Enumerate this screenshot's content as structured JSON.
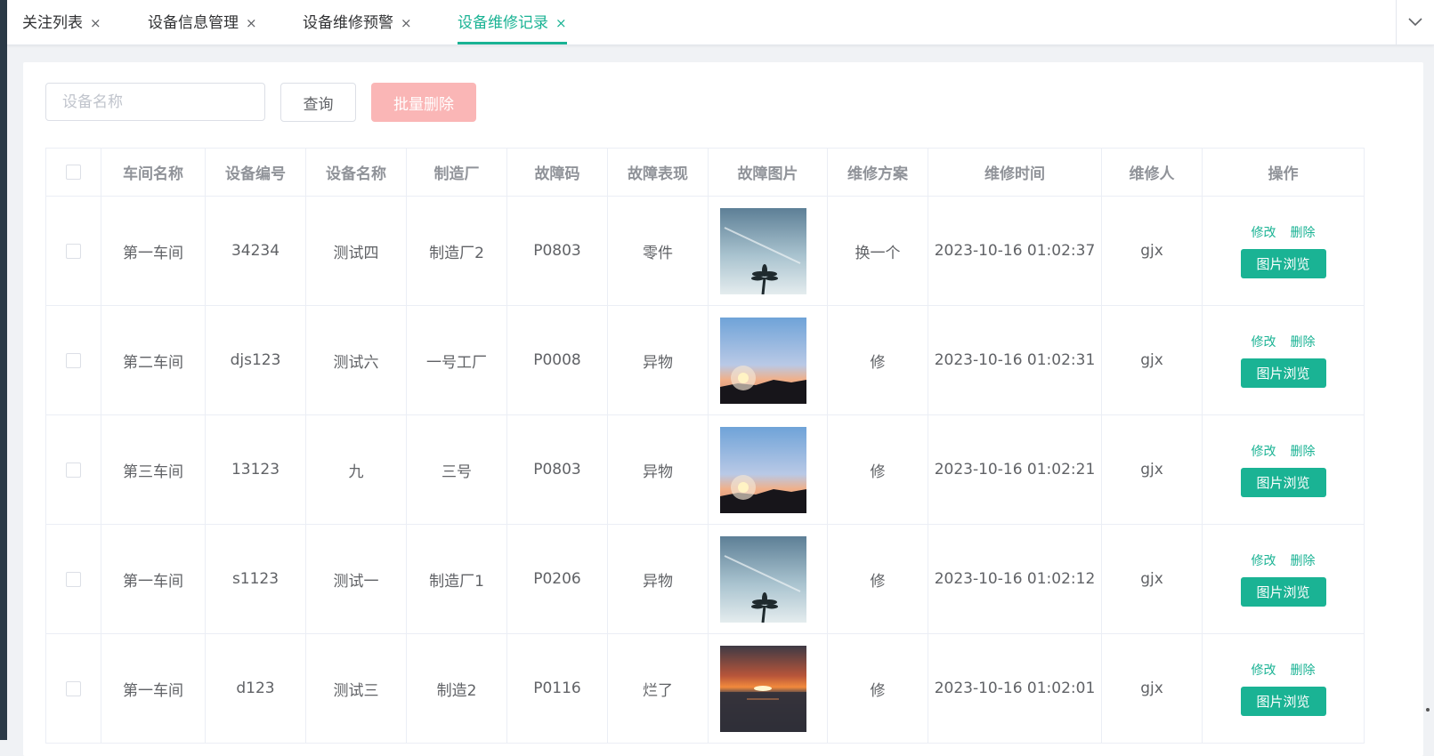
{
  "tabs": [
    {
      "label": "关注列表",
      "active": false
    },
    {
      "label": "设备信息管理",
      "active": false
    },
    {
      "label": "设备维修预警",
      "active": false
    },
    {
      "label": "设备维修记录",
      "active": true
    }
  ],
  "close_glyph": "×",
  "search": {
    "placeholder": "设备名称",
    "value": ""
  },
  "buttons": {
    "query": "查询",
    "batch_delete": "批量删除"
  },
  "table": {
    "headers": [
      "车间名称",
      "设备编号",
      "设备名称",
      "制造厂",
      "故障码",
      "故障表现",
      "故障图片",
      "维修方案",
      "维修时间",
      "维修人",
      "操作"
    ],
    "rows": [
      {
        "workshop": "第一车间",
        "code": "34234",
        "name": "测试四",
        "factory": "制造厂2",
        "fault_code": "P0803",
        "symptom": "零件",
        "image": "palm-sky",
        "plan": "换一个",
        "time": "2023-10-16 01:02:37",
        "person": "gjx"
      },
      {
        "workshop": "第二车间",
        "code": "djs123",
        "name": "测试六",
        "factory": "一号工厂",
        "fault_code": "P0008",
        "symptom": "异物",
        "image": "dandelion-sunset",
        "plan": "修",
        "time": "2023-10-16 01:02:31",
        "person": "gjx"
      },
      {
        "workshop": "第三车间",
        "code": "13123",
        "name": "九",
        "factory": "三号",
        "fault_code": "P0803",
        "symptom": "异物",
        "image": "dandelion-sunset",
        "plan": "修",
        "time": "2023-10-16 01:02:21",
        "person": "gjx"
      },
      {
        "workshop": "第一车间",
        "code": "s1123",
        "name": "测试一",
        "factory": "制造厂1",
        "fault_code": "P0206",
        "symptom": "异物",
        "image": "palm-sky",
        "plan": "修",
        "time": "2023-10-16 01:02:12",
        "person": "gjx"
      },
      {
        "workshop": "第一车间",
        "code": "d123",
        "name": "测试三",
        "factory": "制造2",
        "fault_code": "P0116",
        "symptom": "烂了",
        "image": "sea-sunset",
        "plan": "修",
        "time": "2023-10-16 01:02:01",
        "person": "gjx"
      }
    ],
    "ops": {
      "edit": "修改",
      "delete": "删除",
      "preview": "图片浏览"
    }
  },
  "colors": {
    "accent": "#1ab394",
    "danger_disabled": "#fab6b6"
  }
}
